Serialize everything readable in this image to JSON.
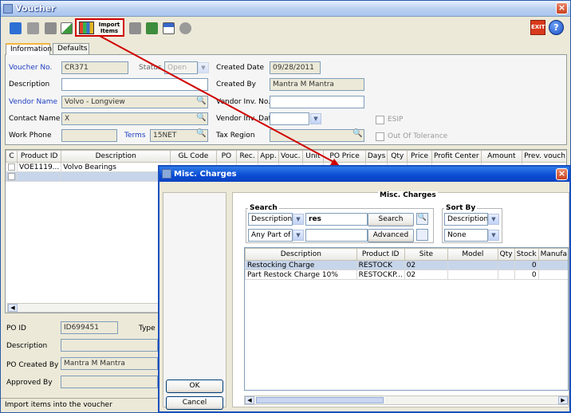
{
  "window": {
    "title": "Voucher"
  },
  "toolbar": {
    "import_label_1": "Import",
    "import_label_2": "Items",
    "exit_label": "EXIT",
    "help_label": "?"
  },
  "tabs": [
    "Information",
    "Defaults"
  ],
  "form": {
    "voucher_no_label": "Voucher No.",
    "voucher_no": "CR371",
    "status_label": "Status",
    "status": "Open",
    "created_date_label": "Created Date",
    "created_date": "09/28/2011",
    "description_label": "Description",
    "description": "",
    "created_by_label": "Created By",
    "created_by": "Mantra M Mantra",
    "vendor_name_label": "Vendor Name",
    "vendor_name": "Volvo - Longview",
    "vendor_inv_no_label": "Vendor Inv. No.",
    "vendor_inv_no": "",
    "contact_name_label": "Contact Name",
    "contact_name": "X",
    "vendor_inv_date_label": "Vendor Inv. Date",
    "vendor_inv_date": "",
    "esip_label": "ESIP",
    "work_phone_label": "Work Phone",
    "work_phone": "",
    "terms_label": "Terms",
    "terms": "15NET",
    "tax_region_label": "Tax Region",
    "tax_region": "",
    "out_of_tolerance_label": "Out Of Tolerance"
  },
  "items_table": {
    "columns": [
      "C",
      "Product ID",
      "Description",
      "GL Code",
      "PO",
      "Rec.",
      "App.",
      "Vouc.",
      "Unit",
      "PO Price",
      "Days",
      "Qty",
      "Price",
      "Profit Center",
      "Amount",
      "Prev. vouch"
    ],
    "rows": [
      [
        "",
        "VOE1119...",
        "Volvo Bearings",
        "",
        "",
        "",
        "",
        "",
        "",
        "",
        "",
        "",
        "",
        "",
        "",
        ""
      ]
    ]
  },
  "po": {
    "po_id_label": "PO ID",
    "po_id": "ID699451",
    "type_label": "Type",
    "description_label": "Description",
    "po_created_by_label": "PO Created By",
    "po_created_by": "Mantra M Mantra",
    "approved_by_label": "Approved By"
  },
  "statusbar": "Import items into the voucher",
  "dialog": {
    "title": "Misc. Charges",
    "group_title": "Misc. Charges",
    "search_label": "Search",
    "search_field": "Description",
    "search_text": "res",
    "search_button": "Search",
    "match_mode": "Any Part of ...",
    "advanced_button": "Advanced",
    "sort_label": "Sort By",
    "sort_field": "Description",
    "sort_order": "None",
    "columns": [
      "Description",
      "Product ID",
      "Site",
      "Model",
      "Qty",
      "Stock",
      "Manufa"
    ],
    "rows": [
      [
        "Restocking Charge",
        "RESTOCK",
        "02",
        "",
        "",
        "0",
        ""
      ],
      [
        "Part Restock Charge 10%",
        "RESTOCKP...",
        "02",
        "",
        "",
        "0",
        ""
      ]
    ],
    "ok_button": "OK",
    "cancel_button": "Cancel"
  },
  "colors": {
    "annotation": "#d00000",
    "dialog_title": "#0a4bd4"
  }
}
